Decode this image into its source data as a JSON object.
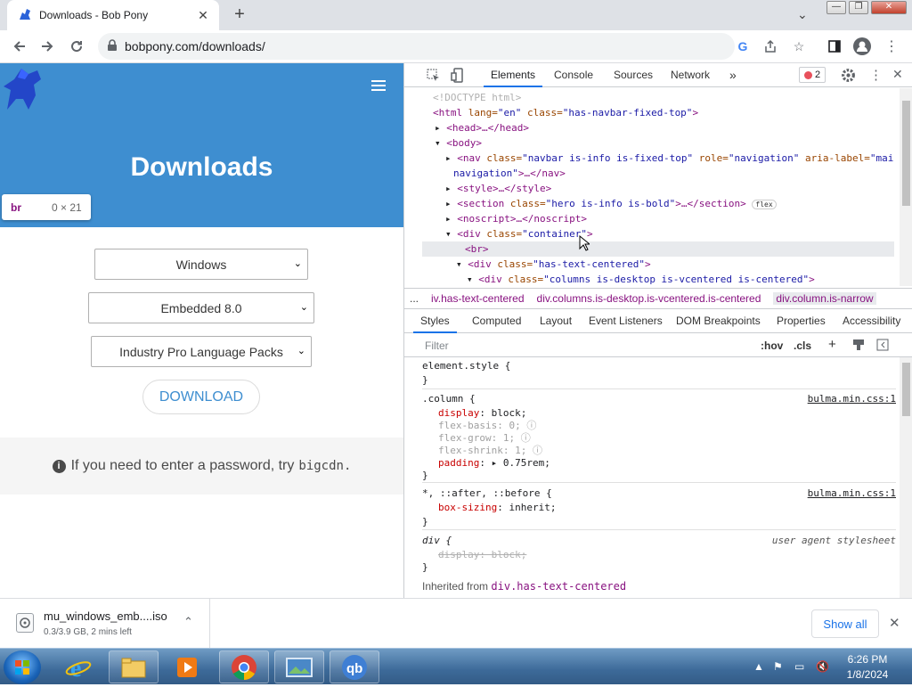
{
  "browser": {
    "tab_title": "Downloads - Bob Pony",
    "url": "bobpony.com/downloads/",
    "window_buttons": [
      "minimize",
      "restore",
      "close"
    ]
  },
  "page": {
    "heading": "Downloads",
    "tooltip": {
      "tag": "br",
      "dims": "0 × 21"
    },
    "selects": {
      "os": "Windows",
      "edition": "Embedded 8.0",
      "package": "Industry Pro Language Packs"
    },
    "download_label": "DOWNLOAD",
    "note_text": "If you need to enter a password, try",
    "note_code": "bigcdn."
  },
  "devtools": {
    "tabs": [
      "Elements",
      "Console",
      "Sources",
      "Network"
    ],
    "more": "»",
    "error_count": "2",
    "dom_lines": {
      "l1": "<!DOCTYPE html>",
      "l2a": "<html",
      "l2b": " lang=",
      "l2c": "\"en\"",
      "l2d": " class=",
      "l2e": "\"has-navbar-fixed-top\"",
      "l2f": ">",
      "l3": "<head>…</head>",
      "l4": "<body>",
      "l5a": "<nav",
      "l5b": " class=",
      "l5c": "\"navbar is-info is-fixed-top\"",
      "l5d": " role=",
      "l5e": "\"navigation\"",
      "l5f": " aria-label=",
      "l5g": "\"main",
      "l6a": "navigation\"",
      "l6b": ">…</nav>",
      "l7": "<style>…</style>",
      "l8a": "<section",
      "l8b": " class=",
      "l8c": "\"hero is-info is-bold\"",
      "l8d": ">…</section>",
      "l8badge": "flex",
      "l9": "<noscript>…</noscript>",
      "l10a": "<div",
      "l10b": " class=",
      "l10c": "\"container\"",
      "l10d": ">",
      "l11": "<br>",
      "l12a": "<div",
      "l12b": " class=",
      "l12c": "\"has-text-centered\"",
      "l12d": ">",
      "l13a": "<div",
      "l13b": " class=",
      "l13c": "\"columns is-desktop is-vcentered is-centered\"",
      "l13d": ">"
    },
    "breadcrumbs": [
      "...",
      "iv.has-text-centered",
      "div.columns.is-desktop.is-vcentered.is-centered",
      "div.column.is-narrow"
    ],
    "sub_tabs": [
      "Styles",
      "Computed",
      "Layout",
      "Event Listeners",
      "DOM Breakpoints",
      "Properties",
      "Accessibility"
    ],
    "filter_placeholder": "Filter",
    "hov": ":hov",
    "cls": ".cls",
    "rules": {
      "r1_sel": "element.style {",
      "close": "}",
      "r2_sel": ".column {",
      "r2_src": "bulma.min.css:1",
      "r2_p1n": "display",
      "r2_p1v": "block;",
      "r2_p2n": "flex-basis",
      "r2_p2v": "0;",
      "r2_p3n": "flex-grow",
      "r2_p3v": "1;",
      "r2_p4n": "flex-shrink",
      "r2_p4v": "1;",
      "r2_p5n": "padding",
      "r2_p5v": "0.75rem;",
      "r3_sel": "*, ::after, ::before {",
      "r3_src": "bulma.min.css:1",
      "r3_p1n": "box-sizing",
      "r3_p1v": "inherit;",
      "r4_sel": "div {",
      "r4_src": "user agent stylesheet",
      "r4_p1": "display: block;"
    },
    "inherited_label": "Inherited from",
    "inherited_from": "div.has-text-centered"
  },
  "download_bar": {
    "filename": "mu_windows_emb....iso",
    "status": "0.3/3.9 GB, 2 mins left",
    "show_all": "Show all"
  },
  "taskbar": {
    "time": "6:26 PM",
    "date": "1/8/2024"
  }
}
